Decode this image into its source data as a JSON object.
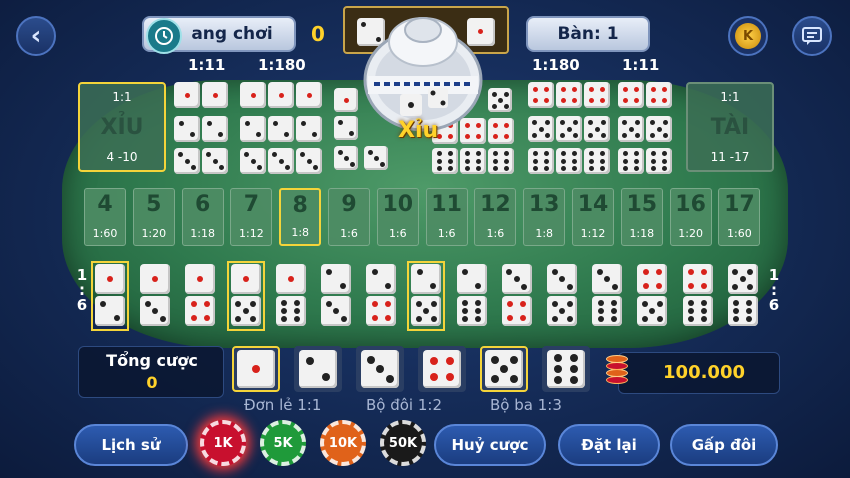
{
  "header": {
    "back_label": "<",
    "room_label": "ang chơi",
    "room_value": "0",
    "table_label": "Bàn: 1",
    "coin_label": "K"
  },
  "center": {
    "result_label": "Xỉu"
  },
  "top_ratios": {
    "left_double": "1:11",
    "left_triple": "1:180",
    "right_triple": "1:180",
    "right_double": "1:11"
  },
  "small_box": {
    "ratio": "1:1",
    "name": "XỈU",
    "range": "4 -10"
  },
  "big_box": {
    "ratio": "1:1",
    "name": "TÀI",
    "range": "11 -17"
  },
  "sums": [
    {
      "n": "4",
      "odds": "1:60"
    },
    {
      "n": "5",
      "odds": "1:20"
    },
    {
      "n": "6",
      "odds": "1:18"
    },
    {
      "n": "7",
      "odds": "1:12"
    },
    {
      "n": "8",
      "odds": "1:8"
    },
    {
      "n": "9",
      "odds": "1:6"
    },
    {
      "n": "10",
      "odds": "1:6"
    },
    {
      "n": "11",
      "odds": "1:6"
    },
    {
      "n": "12",
      "odds": "1:6"
    },
    {
      "n": "13",
      "odds": "1:8"
    },
    {
      "n": "14",
      "odds": "1:12"
    },
    {
      "n": "15",
      "odds": "1:18"
    },
    {
      "n": "16",
      "odds": "1:20"
    },
    {
      "n": "17",
      "odds": "1:60"
    }
  ],
  "pair_side_ratio": [
    "1",
    ":",
    "6"
  ],
  "total_bet": {
    "label": "Tổng cược",
    "value": "0"
  },
  "balance": "100.000",
  "bet_types": [
    "Đơn lẻ 1:1",
    "Bộ đôi 1:2",
    "Bộ ba 1:3"
  ],
  "chips": [
    {
      "label": "1K",
      "color": "#c8102e"
    },
    {
      "label": "5K",
      "color": "#1f9a3a"
    },
    {
      "label": "10K",
      "color": "#e0621a"
    },
    {
      "label": "50K",
      "color": "#1a1a1a"
    }
  ],
  "actions": {
    "history": "Lịch sử",
    "cancel": "Huỷ cược",
    "reset": "Đặt lại",
    "double": "Gấp đôi"
  },
  "colors": {
    "accent": "#f4d43a",
    "felt": "#2f7a4e",
    "background": "#142a55"
  }
}
